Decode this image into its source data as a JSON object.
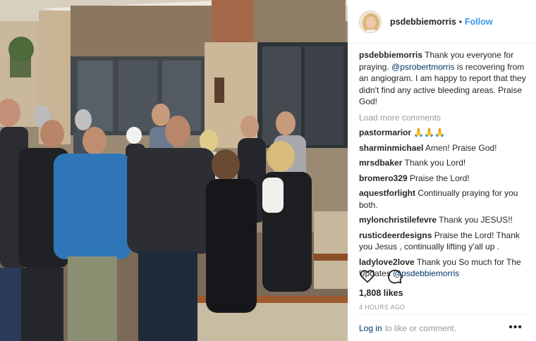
{
  "post": {
    "username": "psdebbiemorris",
    "separator": "•",
    "follow_label": "Follow",
    "caption": {
      "username": "psdebbiemorris",
      "text_before": "Thank you everyone for praying.",
      "mention": "@psrobertmorris",
      "text_after": "is recovering from an angiogram. I am happy to report that they didn't find any active bleeding areas. Praise God!"
    },
    "load_more_label": "Load more comments",
    "comments": [
      {
        "username": "pastormarior",
        "text": "🙏🙏🙏"
      },
      {
        "username": "sharminmichael",
        "text": "Amen! Praise God!"
      },
      {
        "username": "mrsdbaker",
        "text": "Thank you Lord!"
      },
      {
        "username": "bromero329",
        "text": "Praise the Lord!"
      },
      {
        "username": "aquestforlight",
        "text": "Continually praying for you both."
      },
      {
        "username": "mylonchristilefevre",
        "text": "Thank you JESUS!!"
      },
      {
        "username": "rusticdeerdesigns",
        "text": "Praise the Lord! Thank you Jesus , continually lifting y'all up ."
      },
      {
        "username": "ladylove2love",
        "text": "Thank you So much for The Updates",
        "mention": "@psdebbiemorris"
      }
    ],
    "likes": "1,808 likes",
    "timestamp": "4 HOURS AGO",
    "login_link": "Log in",
    "login_rest": "to like or comment.",
    "more_glyph": "•••"
  },
  "icons": {
    "like": "heart-icon",
    "comment": "speech-bubble-icon",
    "options": "more-options-icon"
  },
  "colors": {
    "link_blue": "#3897f0",
    "mention_blue": "#003569",
    "muted_gray": "#999999",
    "text_dark": "#262626"
  }
}
